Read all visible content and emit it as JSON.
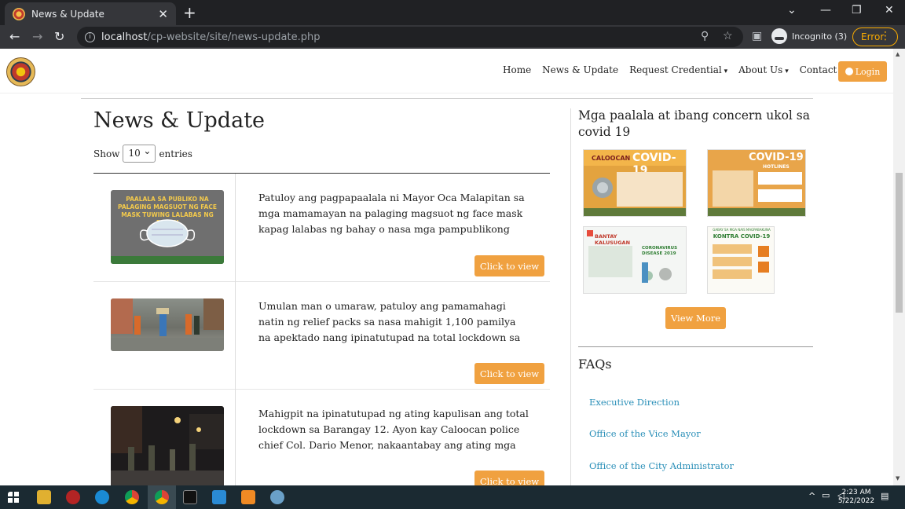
{
  "browser": {
    "tab_title": "News & Update",
    "url_host": "localhost",
    "url_path": "/cp-website/site/news-update.php",
    "incognito_label": "Incognito (3)",
    "error_label": "Error"
  },
  "nav": {
    "home": "Home",
    "news": "News & Update",
    "request": "Request Credential",
    "about": "About Us",
    "contact": "Contact Us",
    "login": "Login"
  },
  "main": {
    "title": "News & Update",
    "show_label": "Show",
    "entries_value": "10",
    "entries_label": "entries",
    "button_label": "Click to view",
    "items": [
      {
        "text": "Patuloy ang pagpapaalala ni Mayor Oca Malapitan sa mga mamamayan na palaging magsuot ng face mask kapag lalabas ng bahay o nasa mga pampublikong lugar.",
        "thumb_caption": "PAALALA SA PUBLIKO NA PALAGING MAGSUOT NG FACE MASK TUWING LALABAS NG BAHAY"
      },
      {
        "text": "Umulan man o umaraw, patuloy ang pamamahagi natin ng relief packs sa nasa mahigit 1,100 pamilya na apektado nang ipinatutupad na total lockdown sa barangay."
      },
      {
        "text": "Mahigpit na ipinatutupad ng ating kapulisan ang total lockdown sa Barangay 12. Ayon kay Caloocan police chief Col. Dario Menor, nakaantabay ang ating mga pulis."
      }
    ]
  },
  "sidebar": {
    "title": "Mga paalala at ibang concern ukol sa covid 19",
    "images": [
      {
        "label": "COVID-19",
        "subtitle": "CALOOCAN"
      },
      {
        "label": "COVID-19",
        "subtitle": "HOTLINES"
      },
      {
        "label": "BANTAY KALUSUGAN",
        "subtitle": "CORONAVIRUS DISEASE 2019"
      },
      {
        "label": "KONTRA COVID-19",
        "subtitle": "GABAY SA MGA NAIS MAGPABAKUNA"
      }
    ],
    "view_more": "View More",
    "faq_title": "FAQs",
    "faq_links": [
      "Executive Direction",
      "Office of the Vice Mayor",
      "Office of the City Administrator"
    ]
  },
  "taskbar": {
    "time": "2:23 AM",
    "date": "5/22/2022"
  },
  "colors": {
    "accent": "#f0a140",
    "link": "#2a8fb8"
  }
}
